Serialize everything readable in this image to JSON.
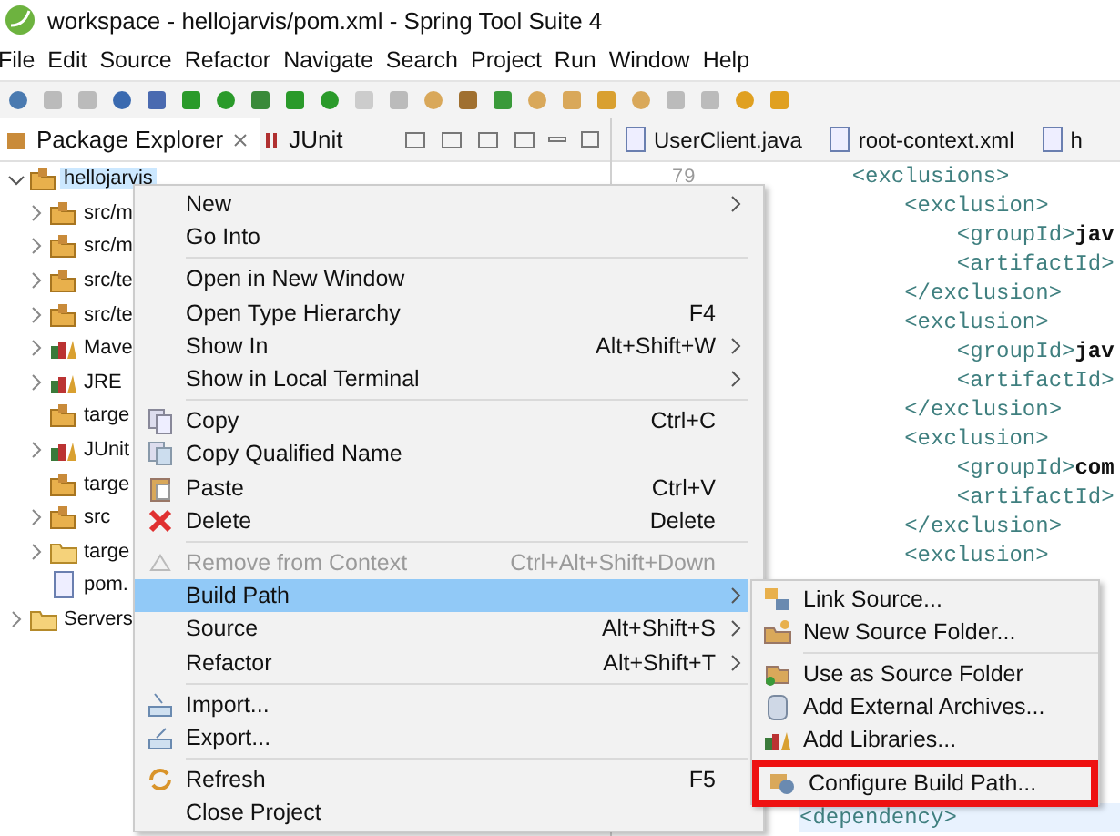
{
  "window": {
    "title": "workspace - hellojarvis/pom.xml - Spring Tool Suite 4"
  },
  "menu_bar": [
    "File",
    "Edit",
    "Source",
    "Refactor",
    "Navigate",
    "Search",
    "Project",
    "Run",
    "Window",
    "Help"
  ],
  "left_tabs": [
    {
      "label": "Package Explorer",
      "selected": true
    },
    {
      "label": "JUnit",
      "selected": false
    }
  ],
  "tree": [
    {
      "label": "hellojarvis",
      "kind": "node",
      "expanded": true,
      "selected": true,
      "children": [
        {
          "label": "src/m",
          "kind": "node",
          "expanded": false,
          "selected": false
        },
        {
          "label": "src/m",
          "kind": "node",
          "expanded": false,
          "selected": false
        },
        {
          "label": "src/te",
          "kind": "node",
          "expanded": false,
          "selected": false
        },
        {
          "label": "src/te",
          "kind": "node",
          "expanded": false,
          "selected": false
        },
        {
          "label": "Mave",
          "kind": "node",
          "expanded": false,
          "selected": false
        },
        {
          "label": "JRE",
          "kind": "node",
          "expanded": false,
          "selected": false
        },
        {
          "label": "targe",
          "kind": "leaf",
          "selected": false
        },
        {
          "label": "JUnit",
          "kind": "node",
          "expanded": false,
          "selected": false
        },
        {
          "label": "targe",
          "kind": "leaf",
          "selected": false
        },
        {
          "label": "src",
          "kind": "node",
          "expanded": false,
          "selected": false
        },
        {
          "label": "targe",
          "kind": "node",
          "expanded": false,
          "selected": false
        },
        {
          "label": "pom.",
          "kind": "leaf",
          "selected": false
        }
      ]
    },
    {
      "label": "Servers",
      "kind": "node",
      "expanded": false,
      "selected": false
    }
  ],
  "editor_tabs": [
    {
      "label": "UserClient.java",
      "selected": false
    },
    {
      "label": "root-context.xml",
      "selected": false
    },
    {
      "label": "h",
      "selected": false
    }
  ],
  "editor": {
    "line_number": "79",
    "lines": [
      "    <exclusions>",
      "        <exclusion>",
      "            <groupId>jav",
      "            <artifactId>",
      "        </exclusion>",
      "        <exclusion>",
      "            <groupId>jav",
      "            <artifactId>",
      "        </exclusion>",
      "        <exclusion>",
      "            <groupId>com",
      "            <artifactId>",
      "        </exclusion>",
      "        <exclusion>"
    ],
    "last_line": "<dependency>"
  },
  "context_menu": [
    {
      "kind": "item",
      "label": "New",
      "submenu": true,
      "disabled": false,
      "selected": false
    },
    {
      "kind": "item",
      "label": "Go Into",
      "submenu": false,
      "disabled": false,
      "selected": false
    },
    {
      "kind": "separator"
    },
    {
      "kind": "item",
      "label": "Open in New Window",
      "submenu": false,
      "disabled": false,
      "selected": false
    },
    {
      "kind": "item",
      "label": "Open Type Hierarchy",
      "shortcut": "F4",
      "submenu": false,
      "disabled": false,
      "selected": false
    },
    {
      "kind": "item",
      "label": "Show In",
      "shortcut": "Alt+Shift+W",
      "submenu": true,
      "disabled": false,
      "selected": false
    },
    {
      "kind": "item",
      "label": "Show in Local Terminal",
      "submenu": true,
      "disabled": false,
      "selected": false
    },
    {
      "kind": "separator"
    },
    {
      "kind": "item",
      "label": "Copy",
      "shortcut": "Ctrl+C",
      "submenu": false,
      "disabled": false,
      "selected": false
    },
    {
      "kind": "item",
      "label": "Copy Qualified Name",
      "submenu": false,
      "disabled": false,
      "selected": false
    },
    {
      "kind": "item",
      "label": "Paste",
      "shortcut": "Ctrl+V",
      "submenu": false,
      "disabled": false,
      "selected": false
    },
    {
      "kind": "item",
      "label": "Delete",
      "shortcut": "Delete",
      "submenu": false,
      "disabled": false,
      "selected": false
    },
    {
      "kind": "separator"
    },
    {
      "kind": "item",
      "label": "Remove from Context",
      "shortcut": "Ctrl+Alt+Shift+Down",
      "submenu": false,
      "disabled": true,
      "selected": false
    },
    {
      "kind": "item",
      "label": "Build Path",
      "submenu": true,
      "disabled": false,
      "selected": true
    },
    {
      "kind": "item",
      "label": "Source",
      "shortcut": "Alt+Shift+S",
      "submenu": true,
      "disabled": false,
      "selected": false
    },
    {
      "kind": "item",
      "label": "Refactor",
      "shortcut": "Alt+Shift+T",
      "submenu": true,
      "disabled": false,
      "selected": false
    },
    {
      "kind": "separator"
    },
    {
      "kind": "item",
      "label": "Import...",
      "submenu": false,
      "disabled": false,
      "selected": false
    },
    {
      "kind": "item",
      "label": "Export...",
      "submenu": false,
      "disabled": false,
      "selected": false
    },
    {
      "kind": "separator"
    },
    {
      "kind": "item",
      "label": "Refresh",
      "shortcut": "F5",
      "submenu": false,
      "disabled": false,
      "selected": false
    },
    {
      "kind": "item",
      "label": "Close Project",
      "submenu": false,
      "disabled": false,
      "selected": false
    }
  ],
  "build_path_submenu": [
    {
      "kind": "item",
      "label": "Link Source...",
      "highlighted": false
    },
    {
      "kind": "item",
      "label": "New Source Folder...",
      "highlighted": false
    },
    {
      "kind": "separator"
    },
    {
      "kind": "item",
      "label": "Use as Source Folder",
      "highlighted": false
    },
    {
      "kind": "item",
      "label": "Add External Archives...",
      "highlighted": false
    },
    {
      "kind": "item",
      "label": "Add Libraries...",
      "highlighted": false
    },
    {
      "kind": "separator"
    },
    {
      "kind": "item",
      "label": "Configure Build Path...",
      "highlighted": true
    }
  ]
}
